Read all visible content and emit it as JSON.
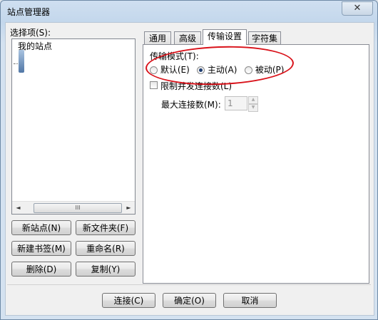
{
  "window": {
    "title": "站点管理器",
    "close_symbol": "✕"
  },
  "left": {
    "select_label": "选择项(S):",
    "tree_root": "我的站点",
    "scroll_thumb": "III",
    "scroll_left": "◄",
    "scroll_right": "►"
  },
  "buttons": {
    "new_site": "新站点(N)",
    "new_folder": "新文件夹(F)",
    "new_bookmark": "新建书签(M)",
    "rename": "重命名(R)",
    "delete": "删除(D)",
    "copy": "复制(Y)",
    "connect": "连接(C)",
    "ok": "确定(O)",
    "cancel": "取消"
  },
  "tabs": [
    {
      "label": "通用"
    },
    {
      "label": "高级"
    },
    {
      "label": "传输设置",
      "active": true
    },
    {
      "label": "字符集"
    }
  ],
  "transfer": {
    "mode_label": "传输模式(T):",
    "options": [
      {
        "label": "默认(E)",
        "selected": false
      },
      {
        "label": "主动(A)",
        "selected": true
      },
      {
        "label": "被动(P)",
        "selected": false
      }
    ],
    "limit_label": "限制并发连接数(L)",
    "limit_checked": false,
    "max_label": "最大连接数(M):",
    "max_value": "1"
  },
  "colors": {
    "annotation": "#d9121a",
    "accent": "#1c3c70"
  }
}
